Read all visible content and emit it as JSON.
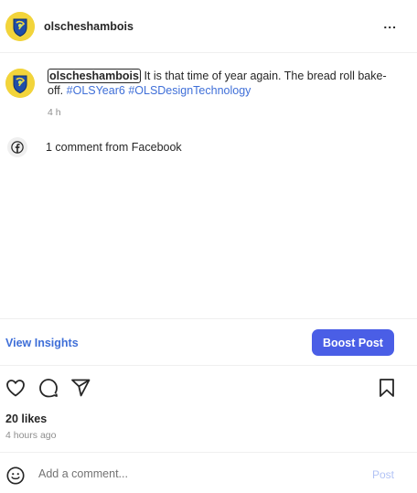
{
  "header": {
    "username": "olscheshambois",
    "more_label": "..."
  },
  "caption": {
    "username": "olscheshambois",
    "text": "It is that time of year again. The bread roll bake-off.",
    "hashtags": [
      "#OLSYear6",
      "#OLSDesignTechnology"
    ],
    "time": "4 h"
  },
  "facebook": {
    "icon": "facebook-icon",
    "text": "1 comment from Facebook"
  },
  "insights": {
    "view_label": "View Insights",
    "boost_label": "Boost Post"
  },
  "actions": {
    "icons": [
      "heart-icon",
      "comment-icon",
      "share-icon",
      "save-icon"
    ]
  },
  "stats": {
    "likes": "20 likes",
    "time_ago": "4 hours ago"
  },
  "comment": {
    "placeholder": "Add a comment...",
    "post_label": "Post"
  },
  "colors": {
    "accent": "#4a5ee6",
    "link": "#3f6fd8",
    "muted": "#8e8e8e",
    "post_disabled": "#b2c3f5"
  }
}
